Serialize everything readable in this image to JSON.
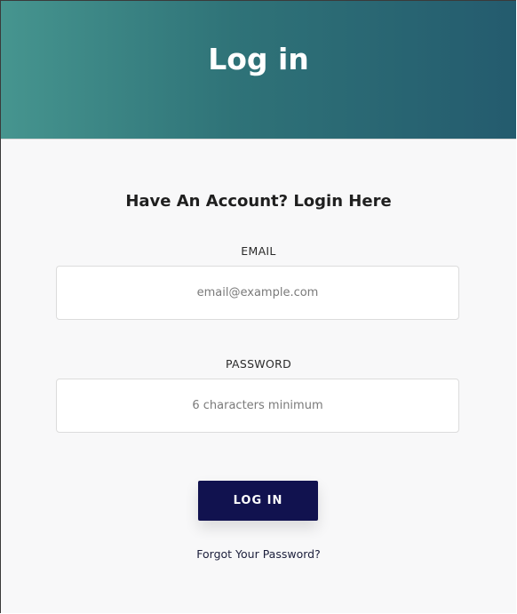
{
  "header": {
    "title": "Log in"
  },
  "form": {
    "heading": "Have An Account? Login Here",
    "email": {
      "label": "EMAIL",
      "placeholder": "email@example.com",
      "value": ""
    },
    "password": {
      "label": "PASSWORD",
      "placeholder": "6 characters minimum",
      "value": ""
    },
    "submit_label": "LOG IN",
    "forgot_label": "Forgot Your Password?"
  },
  "colors": {
    "header_gradient_start": "#46958f",
    "header_gradient_end": "#245b6e",
    "button_background": "#11124f",
    "page_background": "#f8f8f9"
  }
}
